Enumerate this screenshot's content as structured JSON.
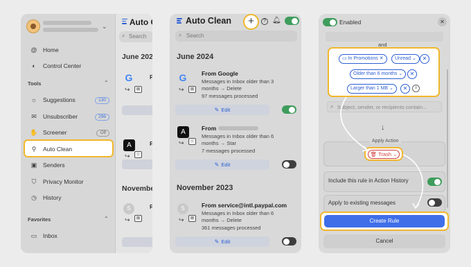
{
  "panel1": {
    "nav_main": [
      {
        "label": "Home",
        "icon": "at-icon"
      },
      {
        "label": "Control Center",
        "icon": "toggle-icon"
      }
    ],
    "tools_title": "Tools",
    "tools": [
      {
        "label": "Suggestions",
        "icon": "bulb-icon",
        "count": "130"
      },
      {
        "label": "Unsubscriber",
        "icon": "mail-minus-icon",
        "count": "296"
      },
      {
        "label": "Screener",
        "icon": "hand-icon",
        "count": "Off"
      },
      {
        "label": "Auto Clean",
        "icon": "broom-icon",
        "count": ""
      },
      {
        "label": "Senders",
        "icon": "contacts-icon",
        "count": ""
      },
      {
        "label": "Privacy Monitor",
        "icon": "shield-icon",
        "count": ""
      },
      {
        "label": "History",
        "icon": "clock-icon",
        "count": ""
      }
    ],
    "favorites_title": "Favorites",
    "favorites": [
      {
        "label": "Inbox",
        "icon": "inbox-icon"
      }
    ],
    "peek": {
      "title": "Auto C",
      "search_placeholder": "Search",
      "date1": "June 2024",
      "date2": "November",
      "rule_prefix": "F"
    }
  },
  "panel2": {
    "title": "Auto Clean",
    "search_placeholder": "Search",
    "sections": [
      {
        "date": "June 2024",
        "rules": [
          {
            "from": "From Google",
            "desc": "Messages in Inbox older than 3 months → Delete",
            "processed": "97 messages processed",
            "edit": "Edit",
            "enabled": true,
            "avatar": "G"
          },
          {
            "from": "From",
            "desc": "Messages in Inbox older than 6 months → Star",
            "processed": "7 messages processed",
            "edit": "Edit",
            "enabled": false,
            "avatar": "A"
          }
        ]
      },
      {
        "date": "November 2023",
        "rules": [
          {
            "from": "From service@intl.paypal.com",
            "desc": "Messages in Inbox older than 6 months → Delete",
            "processed": "361 messages processed",
            "edit": "Edit",
            "enabled": false,
            "avatar": "S"
          }
        ]
      }
    ]
  },
  "panel3": {
    "enabled_label": "Enabled",
    "and_label": "and",
    "conditions": {
      "in_promotions": "In Promotions",
      "unread": "Unread",
      "older": "Older than 6 months",
      "larger": "Larger than 1 MB"
    },
    "search_placeholder": "Subject, sender, or recipients contain...",
    "apply_action_label": "Apply Action",
    "action": "Trash",
    "history_label": "Include this rule in Action History",
    "existing_label": "Apply to existing messages",
    "history_on": true,
    "existing_on": false,
    "create_label": "Create Rule",
    "cancel_label": "Cancel"
  },
  "colors": {
    "highlight": "#f1b72c",
    "accent": "#2c5fd3",
    "toggle_on": "#3f9d5c",
    "danger": "#d23d3d"
  }
}
